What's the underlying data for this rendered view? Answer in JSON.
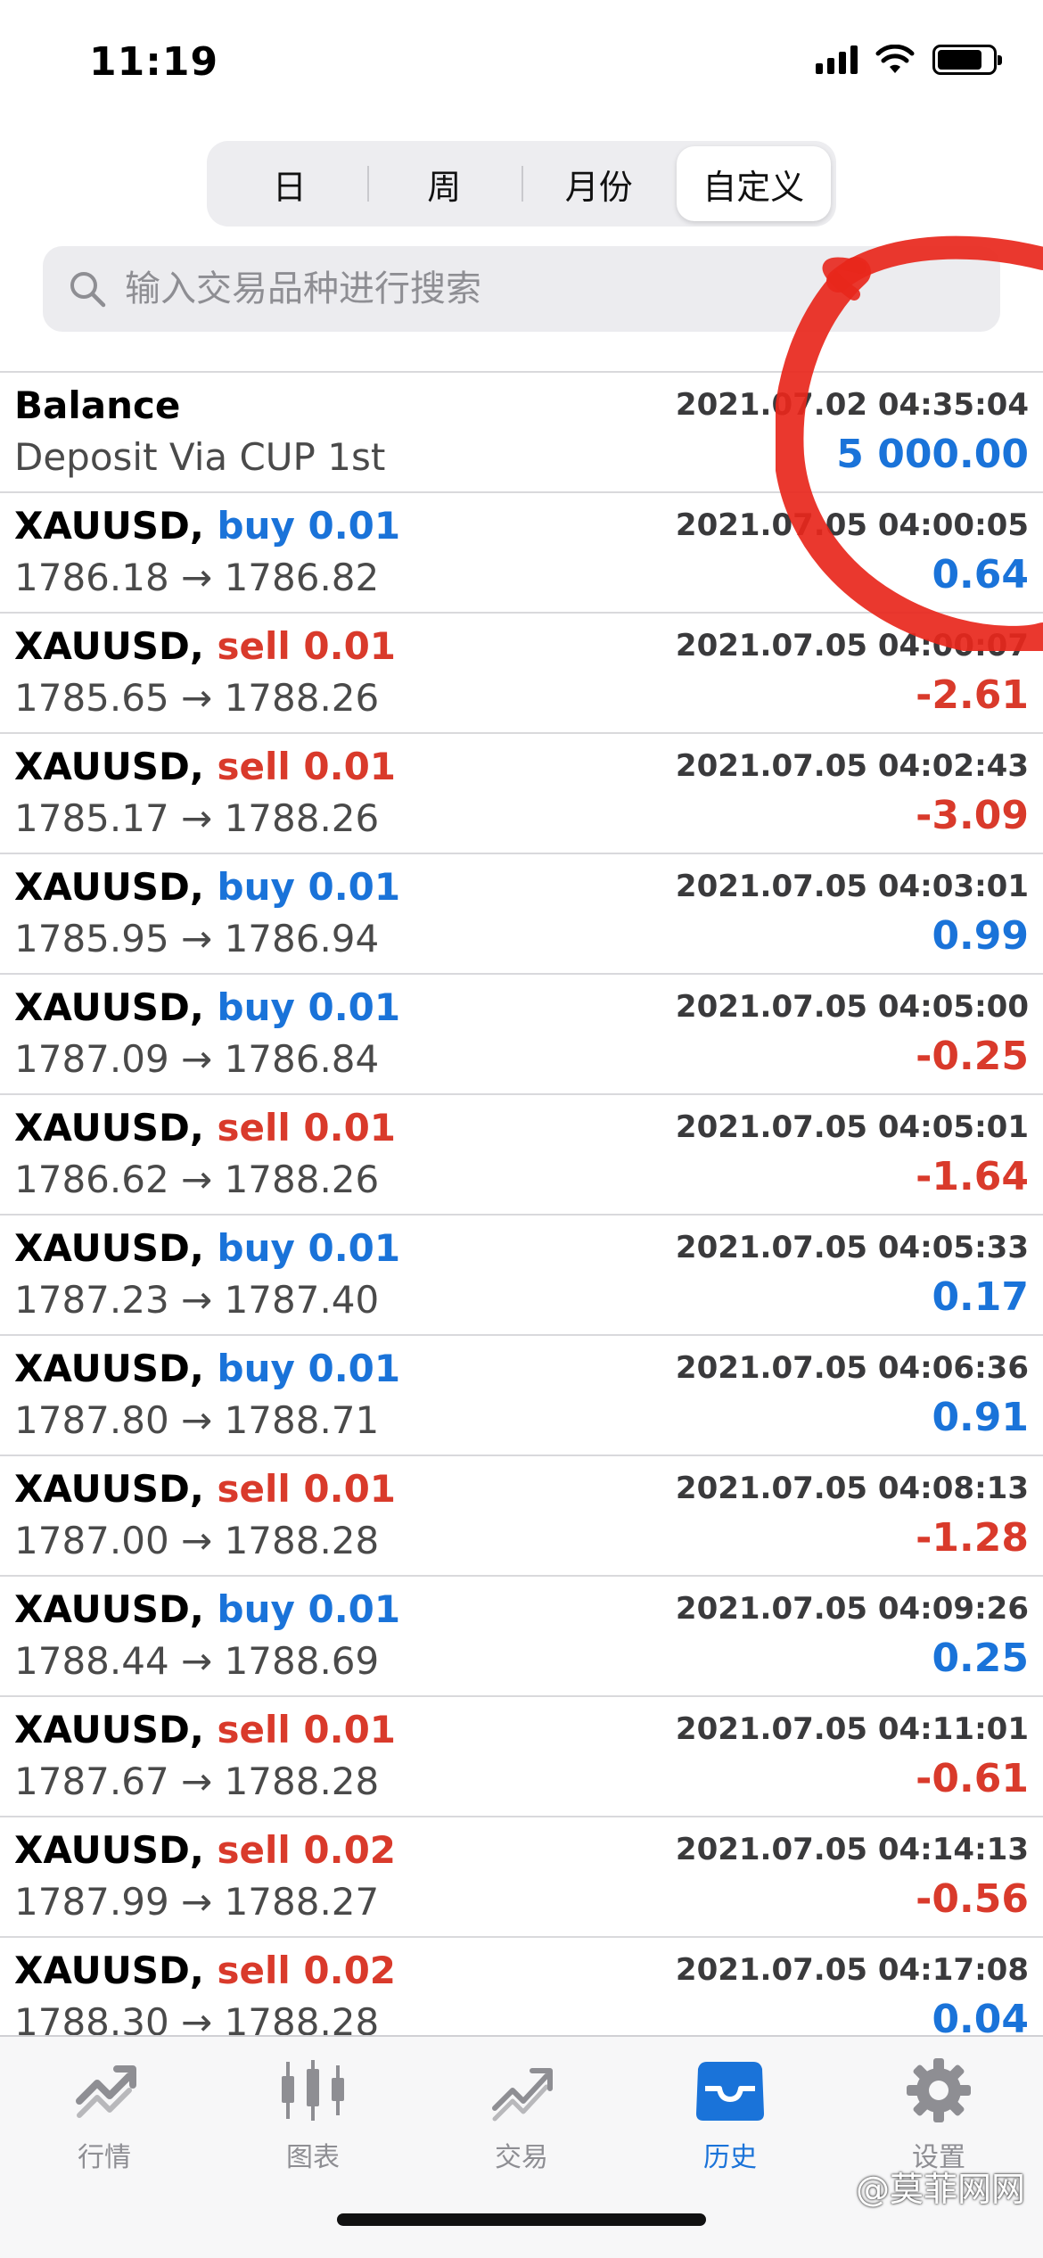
{
  "status_bar": {
    "time": "11:19"
  },
  "segments": [
    "日",
    "周",
    "月份",
    "自定义"
  ],
  "active_segment": "自定义",
  "search": {
    "placeholder": "输入交易品种进行搜索"
  },
  "colors": {
    "buy": "#1a73d9",
    "sell": "#d93a2b",
    "positive": "#1a73d9",
    "negative": "#d93a2b",
    "annotation": "#e8271c"
  },
  "deals": [
    {
      "title": "Balance",
      "type": "",
      "volume": "",
      "time": "2021.07.02 04:35:04",
      "subtitle": "Deposit Via CUP 1st",
      "profit": "5 000.00",
      "profit_sign": "pos"
    },
    {
      "title": "XAUUSD, ",
      "type": "buy",
      "volume": "0.01",
      "time": "2021.07.05 04:00:05",
      "subtitle": "1786.18 → 1786.82",
      "profit": "0.64",
      "profit_sign": "pos"
    },
    {
      "title": "XAUUSD, ",
      "type": "sell",
      "volume": "0.01",
      "time": "2021.07.05 04:00:07",
      "subtitle": "1785.65 → 1788.26",
      "profit": "-2.61",
      "profit_sign": "neg"
    },
    {
      "title": "XAUUSD, ",
      "type": "sell",
      "volume": "0.01",
      "time": "2021.07.05 04:02:43",
      "subtitle": "1785.17 → 1788.26",
      "profit": "-3.09",
      "profit_sign": "neg"
    },
    {
      "title": "XAUUSD, ",
      "type": "buy",
      "volume": "0.01",
      "time": "2021.07.05 04:03:01",
      "subtitle": "1785.95 → 1786.94",
      "profit": "0.99",
      "profit_sign": "pos"
    },
    {
      "title": "XAUUSD, ",
      "type": "buy",
      "volume": "0.01",
      "time": "2021.07.05 04:05:00",
      "subtitle": "1787.09 → 1786.84",
      "profit": "-0.25",
      "profit_sign": "neg"
    },
    {
      "title": "XAUUSD, ",
      "type": "sell",
      "volume": "0.01",
      "time": "2021.07.05 04:05:01",
      "subtitle": "1786.62 → 1788.26",
      "profit": "-1.64",
      "profit_sign": "neg"
    },
    {
      "title": "XAUUSD, ",
      "type": "buy",
      "volume": "0.01",
      "time": "2021.07.05 04:05:33",
      "subtitle": "1787.23 → 1787.40",
      "profit": "0.17",
      "profit_sign": "pos"
    },
    {
      "title": "XAUUSD, ",
      "type": "buy",
      "volume": "0.01",
      "time": "2021.07.05 04:06:36",
      "subtitle": "1787.80 → 1788.71",
      "profit": "0.91",
      "profit_sign": "pos"
    },
    {
      "title": "XAUUSD, ",
      "type": "sell",
      "volume": "0.01",
      "time": "2021.07.05 04:08:13",
      "subtitle": "1787.00 → 1788.28",
      "profit": "-1.28",
      "profit_sign": "neg"
    },
    {
      "title": "XAUUSD, ",
      "type": "buy",
      "volume": "0.01",
      "time": "2021.07.05 04:09:26",
      "subtitle": "1788.44 → 1788.69",
      "profit": "0.25",
      "profit_sign": "pos"
    },
    {
      "title": "XAUUSD, ",
      "type": "sell",
      "volume": "0.01",
      "time": "2021.07.05 04:11:01",
      "subtitle": "1787.67 → 1788.28",
      "profit": "-0.61",
      "profit_sign": "neg"
    },
    {
      "title": "XAUUSD, ",
      "type": "sell",
      "volume": "0.02",
      "time": "2021.07.05 04:14:13",
      "subtitle": "1787.99 → 1788.27",
      "profit": "-0.56",
      "profit_sign": "neg"
    },
    {
      "title": "XAUUSD, ",
      "type": "sell",
      "volume": "0.02",
      "time": "2021.07.05 04:17:08",
      "subtitle": "1788.30 → 1788.28",
      "profit": "0.04",
      "profit_sign": "pos"
    }
  ],
  "tabs": [
    {
      "label": "行情",
      "icon": "quotes-icon"
    },
    {
      "label": "图表",
      "icon": "candlestick-chart-icon"
    },
    {
      "label": "交易",
      "icon": "trade-icon"
    },
    {
      "label": "历史",
      "icon": "history-inbox-icon"
    },
    {
      "label": "设置",
      "icon": "gear-icon"
    }
  ],
  "active_tab": "历史",
  "watermark": "@莫菲网网"
}
